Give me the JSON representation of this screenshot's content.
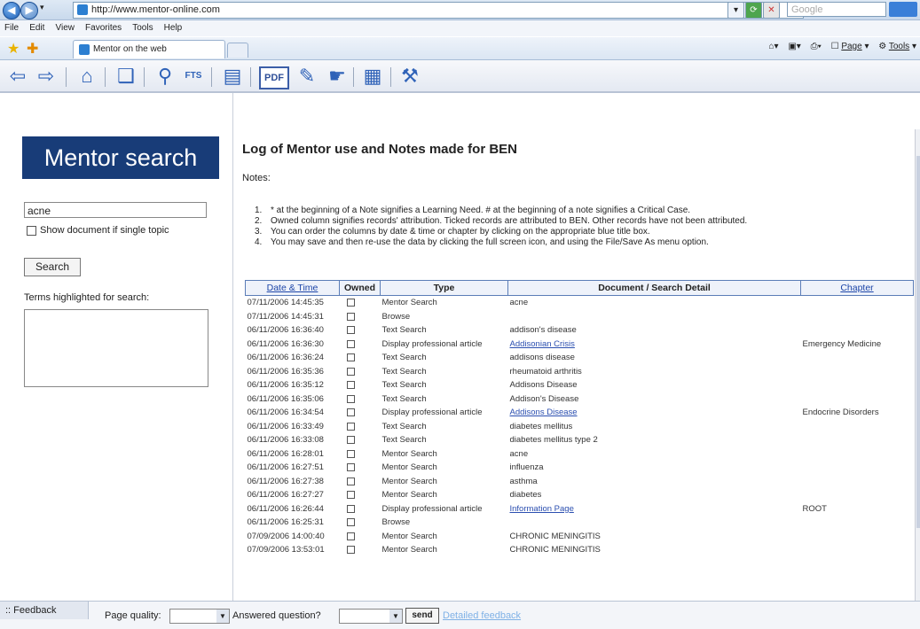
{
  "browser": {
    "url": "http://www.mentor-online.com",
    "search_placeholder": "Google",
    "tab_title": "Mentor on the web",
    "menu": [
      "File",
      "Edit",
      "View",
      "Favorites",
      "Tools",
      "Help"
    ],
    "cmd_page": "Page",
    "cmd_tools": "Tools"
  },
  "toolbar": {
    "pdf_label": "PDF",
    "fts_label": "FTS"
  },
  "sidebar": {
    "logo": "Mentor search",
    "search_value": "acne",
    "show_single_topic": "Show document if single topic",
    "search_button": "Search",
    "highlight_label": "Terms highlighted for search:"
  },
  "main": {
    "title": "Log of Mentor use and Notes made for BEN",
    "notes_label": "Notes:",
    "notes": [
      {
        "num": "1.",
        "text": "* at the beginning of a Note signifies a Learning Need. # at the beginning of a note signifies a Critical Case."
      },
      {
        "num": "2.",
        "text": "Owned column signifies records' attribution. Ticked records are attributed to BEN. Other records have not been attributed."
      },
      {
        "num": "3.",
        "text": "You can order the columns by date & time or chapter by clicking on the appropriate blue title box."
      },
      {
        "num": "4.",
        "text": "You may save and then re-use the data by clicking the full screen icon, and using the File/Save As menu option."
      }
    ],
    "table": {
      "headers": [
        "Date & Time",
        "Owned",
        "Type",
        "Document / Search Detail",
        "Chapter"
      ],
      "rows": [
        {
          "datetime": "07/11/2006 14:45:35",
          "type": "Mentor Search",
          "detail": "acne",
          "chapter": ""
        },
        {
          "datetime": "07/11/2006 14:45:31",
          "type": "Browse",
          "detail": "",
          "chapter": ""
        },
        {
          "datetime": "06/11/2006 16:36:40",
          "type": "Text Search",
          "detail": "addison's disease",
          "chapter": ""
        },
        {
          "datetime": "06/11/2006 16:36:30",
          "type": "Display professional article",
          "detail": "Addisonian Crisis",
          "chapter": "Emergency Medicine"
        },
        {
          "datetime": "06/11/2006 16:36:24",
          "type": "Text Search",
          "detail": "addisons disease",
          "chapter": ""
        },
        {
          "datetime": "06/11/2006 16:35:36",
          "type": "Text Search",
          "detail": "rheumatoid arthritis",
          "chapter": ""
        },
        {
          "datetime": "06/11/2006 16:35:12",
          "type": "Text Search",
          "detail": "Addisons Disease",
          "chapter": ""
        },
        {
          "datetime": "06/11/2006 16:35:06",
          "type": "Text Search",
          "detail": "Addison's Disease",
          "chapter": ""
        },
        {
          "datetime": "06/11/2006 16:34:54",
          "type": "Display professional article",
          "detail": "Addisons Disease",
          "chapter": "Endocrine Disorders"
        },
        {
          "datetime": "06/11/2006 16:33:49",
          "type": "Text Search",
          "detail": "diabetes mellitus",
          "chapter": ""
        },
        {
          "datetime": "06/11/2006 16:33:08",
          "type": "Text Search",
          "detail": "diabetes mellitus type 2",
          "chapter": ""
        },
        {
          "datetime": "06/11/2006 16:28:01",
          "type": "Mentor Search",
          "detail": "acne",
          "chapter": ""
        },
        {
          "datetime": "06/11/2006 16:27:51",
          "type": "Mentor Search",
          "detail": "influenza",
          "chapter": ""
        },
        {
          "datetime": "06/11/2006 16:27:38",
          "type": "Mentor Search",
          "detail": "asthma",
          "chapter": ""
        },
        {
          "datetime": "06/11/2006 16:27:27",
          "type": "Mentor Search",
          "detail": "diabetes",
          "chapter": ""
        },
        {
          "datetime": "06/11/2006 16:26:44",
          "type": "Display professional article",
          "detail": "Information Page",
          "chapter": "ROOT"
        },
        {
          "datetime": "06/11/2006 16:25:31",
          "type": "Browse",
          "detail": "",
          "chapter": ""
        },
        {
          "datetime": "07/09/2006 14:00:40",
          "type": "Mentor Search",
          "detail": "CHRONIC MENINGITIS",
          "chapter": ""
        },
        {
          "datetime": "07/09/2006 13:53:01",
          "type": "Mentor Search",
          "detail": "CHRONIC MENINGITIS",
          "chapter": ""
        }
      ]
    }
  },
  "feedback": {
    "tab": ":: Feedback",
    "page_quality": "Page quality:",
    "answered": "Answered question?",
    "send": "send",
    "detailed": "Detailed feedback"
  }
}
